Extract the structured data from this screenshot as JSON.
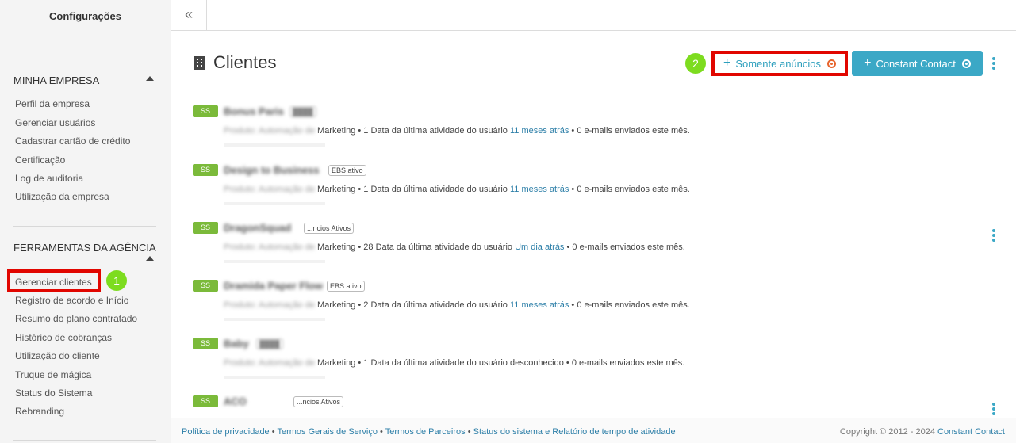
{
  "sidebar": {
    "title": "Configurações",
    "section1": {
      "heading": "MINHA EMPRESA",
      "items": [
        "Perfil da empresa",
        "Gerenciar usuários",
        "Cadastrar cartão de crédito",
        "Certificação",
        "Log de auditoria",
        "Utilização da empresa"
      ]
    },
    "section2": {
      "heading": "FERRAMENTAS DA AGÊNCIA",
      "items": [
        "Gerenciar clientes",
        "Registro de acordo e Início",
        "Resumo do plano contratado",
        "Histórico de cobranças",
        "Utilização do cliente",
        "Truque de mágica",
        "Status do Sistema",
        "Rebranding"
      ]
    },
    "marker1": "1"
  },
  "topbar": {
    "collapse_glyph": "«"
  },
  "header": {
    "title": "Clientes",
    "marker2": "2",
    "ads_button": "Somente anúncios",
    "cc_button": "Constant Contact",
    "plus_glyph": "+"
  },
  "clients": [
    {
      "badge": "SS",
      "name": "Bonus Paris",
      "tag": "████",
      "tag_blurred": true,
      "prefix": "Produto: Automação de ",
      "detail_a": "Marketing • 1 Data da última atividade do usuário ",
      "time": "11 meses atrás",
      "detail_b": " • 0 e-mails enviados este mês."
    },
    {
      "badge": "SS",
      "name": "Design to Business",
      "tag": "EBS ativo",
      "tag_blurred": false,
      "prefix": "Produto: Automação de ",
      "detail_a": "Marketing • 1 Data da última atividade do usuário ",
      "time": "11 meses atrás",
      "detail_b": " • 0 e-mails enviados este mês."
    },
    {
      "badge": "SS",
      "name": "DragonSquad",
      "tag": "...ncios Ativos",
      "tag_blurred": false,
      "prefix": "Produto: Automação de ",
      "detail_a": "Marketing • 28 Data da última atividade do usuário ",
      "time": "Um dia atrás",
      "detail_b": " • 0 e-mails enviados este mês."
    },
    {
      "badge": "SS",
      "name": "Dramida Paper Flow",
      "tag": "EBS ativo",
      "tag_blurred": false,
      "prefix": "Produto: Automação de ",
      "detail_a": "Marketing • 2 Data da última atividade do usuário ",
      "time": "11 meses atrás",
      "detail_b": " • 0 e-mails enviados este mês."
    },
    {
      "badge": "SS",
      "name": "Baby",
      "tag": "████",
      "tag_blurred": true,
      "prefix": "Produto: Automação de ",
      "detail_a": "Marketing • 1 Data da última atividade do usuário desconhecido",
      "time": "",
      "detail_b": " • 0 e-mails enviados este mês."
    },
    {
      "badge": "SS",
      "name": "ACO",
      "tag": "...ncios Ativos",
      "tag_blurred": false,
      "prefix": "",
      "detail_a": "",
      "time": "",
      "detail_b": ""
    }
  ],
  "footer": {
    "links": [
      "Política de privacidade",
      "Termos Gerais de Serviço",
      "Termos de Parceiros",
      "Status do sistema e Relatório de tempo de atividade"
    ],
    "separator": " • ",
    "copyright": "Copyright © 2012 - 2024 ",
    "brand": "Constant Contact"
  },
  "colors": {
    "accent": "#3ba8c6",
    "highlight": "#e10600",
    "marker": "#7ddc1f",
    "ss_badge": "#7bba3a"
  },
  "icons": [
    "building-icon",
    "plus-icon",
    "target-icon",
    "kebab-icon",
    "collapse-icon"
  ]
}
